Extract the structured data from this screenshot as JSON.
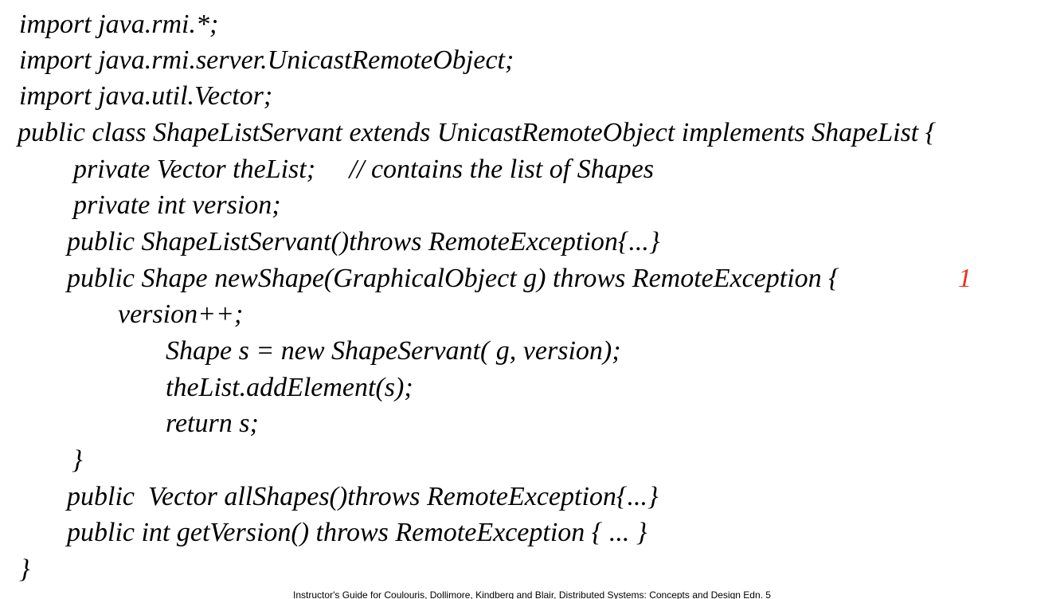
{
  "code": {
    "lines": [
      "import java.rmi.*;",
      "import java.rmi.server.UnicastRemoteObject;",
      "import java.util.Vector;",
      "public class ShapeListServant extends UnicastRemoteObject implements ShapeList {",
      "private Vector theList;     // contains the list of Shapes",
      "private int version;",
      "public ShapeListServant()throws RemoteException{...}",
      "public Shape newShape(GraphicalObject g) throws RemoteException {",
      "version++;",
      "Shape s = new ShapeServant( g, version);",
      "theList.addElement(s);",
      "return s;",
      "}",
      "public  Vector allShapes()throws RemoteException{...}",
      "public int getVersion() throws RemoteException { ... }",
      "}"
    ],
    "marker": {
      "text": "1",
      "color": "#e8321e"
    }
  },
  "footer": {
    "text": "Instructor's Guide for Coulouris, Dollimore, Kindberg and Blair, Distributed Systems: Concepts and Design Edn. 5"
  }
}
